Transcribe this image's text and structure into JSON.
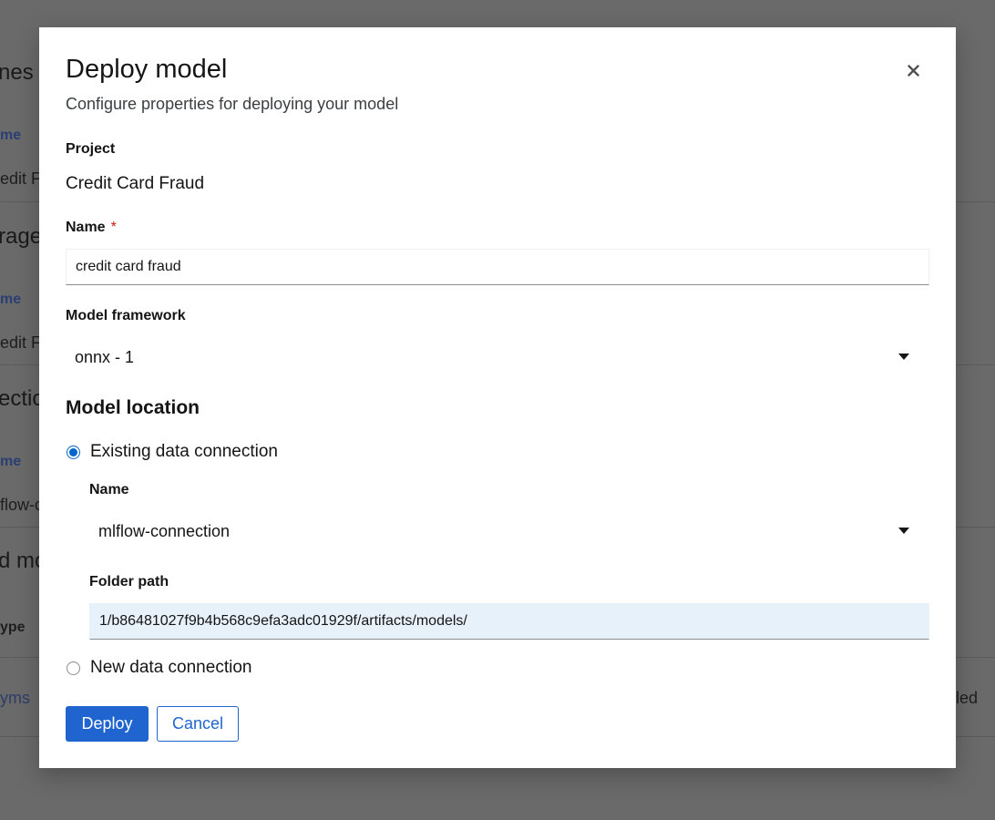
{
  "background": {
    "headings": [
      "nes",
      "rage",
      "ectio",
      "d mo"
    ],
    "column_headers": [
      "me",
      "me",
      "me",
      "ype"
    ],
    "cells": [
      "edit F",
      "edit F",
      "flow-c"
    ],
    "links": [
      "yms"
    ],
    "right_text": "led"
  },
  "modal": {
    "title": "Deploy model",
    "description": "Configure properties for deploying your model",
    "close_icon": "close-icon",
    "project": {
      "label": "Project",
      "value": "Credit Card Fraud"
    },
    "name": {
      "label": "Name",
      "required_marker": "*",
      "value": "credit card fraud"
    },
    "framework": {
      "label": "Model framework",
      "selected": "onnx - 1"
    },
    "location": {
      "title": "Model location",
      "existing": {
        "label": "Existing data connection",
        "checked": true,
        "name_label": "Name",
        "name_selected": "mlflow-connection",
        "folder_label": "Folder path",
        "folder_value": "1/b86481027f9b4b568c9efa3adc01929f/artifacts/models/"
      },
      "new": {
        "label": "New data connection",
        "checked": false
      }
    },
    "buttons": {
      "deploy": "Deploy",
      "cancel": "Cancel"
    }
  },
  "colors": {
    "primary": "#1f64cf",
    "backdrop": "#696969",
    "required": "#c9190b",
    "filled_input": "#e7f1fa"
  }
}
